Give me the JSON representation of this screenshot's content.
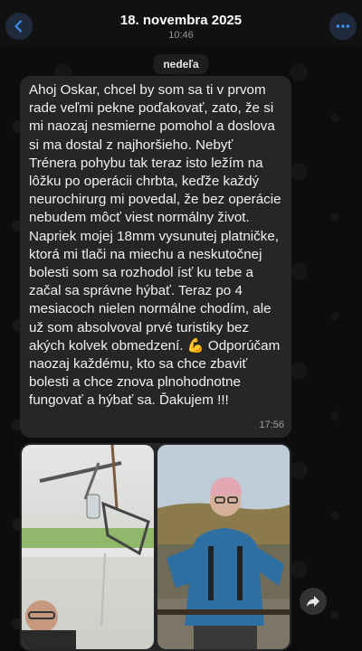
{
  "header": {
    "title": "18. novembra 2025",
    "subtitle": "10:46"
  },
  "chat": {
    "day_label": "nedeľa",
    "message": {
      "text": "Ahoj Oskar, chcel by som sa ti v prvom rade veľmi pekne poďakovať, zato, že si mi naozaj nesmierne pomohol a doslova si ma dostal z najhoršieho. Nebyť Trénera pohybu tak teraz isto ležím na lôžku po operácii chrbta, keďže každý neurochirurg mi povedal, že bez operácie nebudem môcť viest normálny život. Napriek mojej 18mm vysunutej platničke, ktorá mi tlači na miechu a neskutočnej bolesti som sa rozhodol ísť ku tebe a začal sa správne hýbať. Teraz po 4 mesiacoch nielen normálne chodím, ale už som absolvoval prvé turistiky bez akých kolvek obmedzení. 💪 Odporúčam naozaj každému, kto sa chce zbaviť bolesti a chce znova plnohodnotne fungovať a hýbať sa. Ďakujem !!!",
      "time": "17:56"
    }
  },
  "icons": {
    "back": "chevron-left-icon",
    "more": "more-horizontal-icon",
    "forward": "forward-arrow-icon"
  },
  "colors": {
    "accent": "#3a8df5",
    "bubble": "#262628"
  }
}
